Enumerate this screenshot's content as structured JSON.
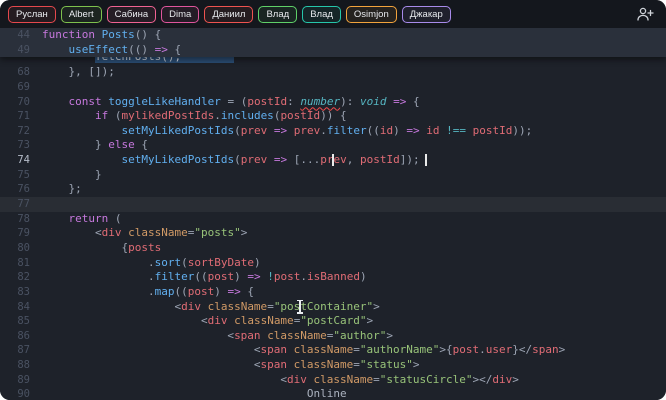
{
  "topbar": {
    "users": [
      {
        "name": "Руслан",
        "color": "#e5484d"
      },
      {
        "name": "Albert",
        "color": "#7ec14d"
      },
      {
        "name": "Сабина",
        "color": "#f06292"
      },
      {
        "name": "Dima",
        "color": "#e0559d"
      },
      {
        "name": "Даниил",
        "color": "#ef5350"
      },
      {
        "name": "Влад",
        "color": "#5fd068"
      },
      {
        "name": "Влад",
        "color": "#26c6aa"
      },
      {
        "name": "Osimjon",
        "color": "#f2a33c"
      },
      {
        "name": "Джакар",
        "color": "#a88beb"
      }
    ],
    "add_user_icon": "person-add"
  },
  "editor": {
    "colors": {
      "bg": "#1e222a",
      "sticky_bg": "#2a303b",
      "topbar_bg": "#14171d",
      "gutter": "#4a5262",
      "selection": "#2b4d74",
      "caret": "#eaeaea",
      "squiggle": "#f14c4c",
      "line_highlight": "rgba(255,255,255,0.05)"
    },
    "palette": {
      "kw": "#c678dd",
      "fn": "#61afef",
      "var": "#e06c75",
      "str": "#98c379",
      "attr": "#d19a66",
      "type": "#56b6c2",
      "op": "#56b6c2",
      "punc": "#9da5b4",
      "plain": "#abb2bf"
    },
    "sticky_lines": [
      {
        "n": 44,
        "t": [
          {
            "t": "function",
            "c": "kw"
          },
          {
            "t": " ",
            "c": "plain"
          },
          {
            "t": "Posts",
            "c": "fn"
          },
          {
            "t": "() {",
            "c": "punc"
          }
        ]
      },
      {
        "n": 49,
        "t": [
          {
            "t": "    ",
            "c": "plain"
          },
          {
            "t": "useEffect",
            "c": "fn"
          },
          {
            "t": "(() ",
            "c": "punc"
          },
          {
            "t": "=>",
            "c": "kw"
          },
          {
            "t": " {",
            "c": "punc"
          }
        ]
      }
    ],
    "partial_line": {
      "indent": "        ",
      "text": "fetchPosts();        "
    },
    "lines": [
      {
        "n": 68,
        "t": [
          {
            "t": "    }, []);",
            "c": "punc"
          }
        ]
      },
      {
        "n": 69,
        "t": []
      },
      {
        "n": 70,
        "t": [
          {
            "t": "    ",
            "c": "plain"
          },
          {
            "t": "const",
            "c": "kw"
          },
          {
            "t": " ",
            "c": "plain"
          },
          {
            "t": "toggleLikeHandler",
            "c": "fn"
          },
          {
            "t": " = (",
            "c": "punc"
          },
          {
            "t": "postId",
            "c": "var"
          },
          {
            "t": ": ",
            "c": "punc"
          },
          {
            "t": "number",
            "c": "type",
            "u": true
          },
          {
            "t": "): ",
            "c": "punc"
          },
          {
            "t": "void",
            "c": "type"
          },
          {
            "t": " ",
            "c": "plain"
          },
          {
            "t": "=>",
            "c": "kw"
          },
          {
            "t": " {",
            "c": "punc"
          }
        ]
      },
      {
        "n": 71,
        "t": [
          {
            "t": "        ",
            "c": "plain"
          },
          {
            "t": "if",
            "c": "kw"
          },
          {
            "t": " (",
            "c": "punc"
          },
          {
            "t": "mylikedPostIds",
            "c": "var"
          },
          {
            "t": ".",
            "c": "punc"
          },
          {
            "t": "includes",
            "c": "fn"
          },
          {
            "t": "(",
            "c": "punc"
          },
          {
            "t": "postId",
            "c": "var"
          },
          {
            "t": ")) {",
            "c": "punc"
          }
        ]
      },
      {
        "n": 72,
        "t": [
          {
            "t": "            ",
            "c": "plain"
          },
          {
            "t": "setMyLikedPostIds",
            "c": "fn"
          },
          {
            "t": "(",
            "c": "punc"
          },
          {
            "t": "prev",
            "c": "var"
          },
          {
            "t": " ",
            "c": "plain"
          },
          {
            "t": "=>",
            "c": "kw"
          },
          {
            "t": " ",
            "c": "plain"
          },
          {
            "t": "prev",
            "c": "var"
          },
          {
            "t": ".",
            "c": "punc"
          },
          {
            "t": "filter",
            "c": "fn"
          },
          {
            "t": "((",
            "c": "punc"
          },
          {
            "t": "id",
            "c": "var"
          },
          {
            "t": ") ",
            "c": "punc"
          },
          {
            "t": "=>",
            "c": "kw"
          },
          {
            "t": " ",
            "c": "plain"
          },
          {
            "t": "id",
            "c": "var"
          },
          {
            "t": " ",
            "c": "plain"
          },
          {
            "t": "!==",
            "c": "op"
          },
          {
            "t": " ",
            "c": "plain"
          },
          {
            "t": "postId",
            "c": "var"
          },
          {
            "t": "));",
            "c": "punc"
          }
        ]
      },
      {
        "n": 73,
        "t": [
          {
            "t": "        } ",
            "c": "punc"
          },
          {
            "t": "else",
            "c": "kw"
          },
          {
            "t": " {",
            "c": "punc"
          }
        ]
      },
      {
        "n": 74,
        "active": true,
        "t": [
          {
            "t": "            ",
            "c": "plain"
          },
          {
            "t": "setMyLikedPostIds",
            "c": "fn"
          },
          {
            "t": "(",
            "c": "punc"
          },
          {
            "t": "prev",
            "c": "var"
          },
          {
            "t": " ",
            "c": "plain"
          },
          {
            "t": "=>",
            "c": "kw"
          },
          {
            "t": " [...",
            "c": "punc"
          },
          {
            "t": "pr",
            "c": "var"
          },
          {
            "s": "caret"
          },
          {
            "t": "ev",
            "c": "var"
          },
          {
            "t": ", ",
            "c": "punc"
          },
          {
            "t": "postId",
            "c": "var"
          },
          {
            "t": "]); ",
            "c": "punc"
          },
          {
            "s": "caret"
          }
        ]
      },
      {
        "n": 75,
        "t": [
          {
            "t": "        }",
            "c": "punc"
          }
        ]
      },
      {
        "n": 76,
        "t": [
          {
            "t": "    };",
            "c": "punc"
          }
        ]
      },
      {
        "n": 77,
        "hl": true,
        "t": []
      },
      {
        "n": 78,
        "t": [
          {
            "t": "    ",
            "c": "plain"
          },
          {
            "t": "return",
            "c": "kw"
          },
          {
            "t": " (",
            "c": "punc"
          }
        ]
      },
      {
        "n": 79,
        "t": [
          {
            "t": "        <",
            "c": "punc"
          },
          {
            "t": "div",
            "c": "var"
          },
          {
            "t": " ",
            "c": "plain"
          },
          {
            "t": "className",
            "c": "attr"
          },
          {
            "t": "=",
            "c": "punc"
          },
          {
            "t": "\"posts\"",
            "c": "str"
          },
          {
            "t": ">",
            "c": "punc"
          }
        ]
      },
      {
        "n": 80,
        "t": [
          {
            "t": "            {",
            "c": "punc"
          },
          {
            "t": "posts",
            "c": "var"
          }
        ]
      },
      {
        "n": 81,
        "t": [
          {
            "t": "                .",
            "c": "punc"
          },
          {
            "t": "sort",
            "c": "fn"
          },
          {
            "t": "(",
            "c": "punc"
          },
          {
            "t": "sortByDate",
            "c": "var"
          },
          {
            "t": ")",
            "c": "punc"
          }
        ]
      },
      {
        "n": 82,
        "t": [
          {
            "t": "                .",
            "c": "punc"
          },
          {
            "t": "filter",
            "c": "fn"
          },
          {
            "t": "((",
            "c": "punc"
          },
          {
            "t": "post",
            "c": "var"
          },
          {
            "t": ") ",
            "c": "punc"
          },
          {
            "t": "=>",
            "c": "kw"
          },
          {
            "t": " ",
            "c": "plain"
          },
          {
            "t": "!",
            "c": "op"
          },
          {
            "t": "post",
            "c": "var"
          },
          {
            "t": ".",
            "c": "punc"
          },
          {
            "t": "isBanned",
            "c": "var"
          },
          {
            "t": ")",
            "c": "punc"
          }
        ]
      },
      {
        "n": 83,
        "t": [
          {
            "t": "                .",
            "c": "punc"
          },
          {
            "t": "map",
            "c": "fn"
          },
          {
            "t": "((",
            "c": "punc"
          },
          {
            "t": "post",
            "c": "var"
          },
          {
            "t": ") ",
            "c": "punc"
          },
          {
            "t": "=>",
            "c": "kw"
          },
          {
            "t": " {",
            "c": "punc"
          }
        ]
      },
      {
        "n": 84,
        "t": [
          {
            "t": "                    <",
            "c": "punc"
          },
          {
            "t": "div",
            "c": "var"
          },
          {
            "t": " ",
            "c": "plain"
          },
          {
            "t": "className",
            "c": "attr"
          },
          {
            "t": "=",
            "c": "punc"
          },
          {
            "t": "\"pos",
            "c": "str"
          },
          {
            "s": "ibeam"
          },
          {
            "t": "tContainer\"",
            "c": "str"
          },
          {
            "t": ">",
            "c": "punc"
          }
        ]
      },
      {
        "n": 85,
        "t": [
          {
            "t": "                        <",
            "c": "punc"
          },
          {
            "t": "div",
            "c": "var"
          },
          {
            "t": " ",
            "c": "plain"
          },
          {
            "t": "className",
            "c": "attr"
          },
          {
            "t": "=",
            "c": "punc"
          },
          {
            "t": "\"postCard\"",
            "c": "str"
          },
          {
            "t": ">",
            "c": "punc"
          }
        ]
      },
      {
        "n": 86,
        "t": [
          {
            "t": "                            <",
            "c": "punc"
          },
          {
            "t": "span",
            "c": "var"
          },
          {
            "t": " ",
            "c": "plain"
          },
          {
            "t": "className",
            "c": "attr"
          },
          {
            "t": "=",
            "c": "punc"
          },
          {
            "t": "\"author\"",
            "c": "str"
          },
          {
            "t": ">",
            "c": "punc"
          }
        ]
      },
      {
        "n": 87,
        "t": [
          {
            "t": "                                <",
            "c": "punc"
          },
          {
            "t": "span",
            "c": "var"
          },
          {
            "t": " ",
            "c": "plain"
          },
          {
            "t": "className",
            "c": "attr"
          },
          {
            "t": "=",
            "c": "punc"
          },
          {
            "t": "\"authorName\"",
            "c": "str"
          },
          {
            "t": ">{",
            "c": "punc"
          },
          {
            "t": "post",
            "c": "var"
          },
          {
            "t": ".",
            "c": "punc"
          },
          {
            "t": "user",
            "c": "var"
          },
          {
            "t": "}</",
            "c": "punc"
          },
          {
            "t": "span",
            "c": "var"
          },
          {
            "t": ">",
            "c": "punc"
          }
        ]
      },
      {
        "n": 88,
        "t": [
          {
            "t": "                                <",
            "c": "punc"
          },
          {
            "t": "span",
            "c": "var"
          },
          {
            "t": " ",
            "c": "plain"
          },
          {
            "t": "className",
            "c": "attr"
          },
          {
            "t": "=",
            "c": "punc"
          },
          {
            "t": "\"status\"",
            "c": "str"
          },
          {
            "t": ">",
            "c": "punc"
          }
        ]
      },
      {
        "n": 89,
        "t": [
          {
            "t": "                                    <",
            "c": "punc"
          },
          {
            "t": "div",
            "c": "var"
          },
          {
            "t": " ",
            "c": "plain"
          },
          {
            "t": "className",
            "c": "attr"
          },
          {
            "t": "=",
            "c": "punc"
          },
          {
            "t": "\"statusCircle\"",
            "c": "str"
          },
          {
            "t": "></",
            "c": "punc"
          },
          {
            "t": "div",
            "c": "var"
          },
          {
            "t": ">",
            "c": "punc"
          }
        ]
      },
      {
        "n": 90,
        "t": [
          {
            "t": "                                        Online",
            "c": "plain"
          }
        ]
      }
    ]
  }
}
